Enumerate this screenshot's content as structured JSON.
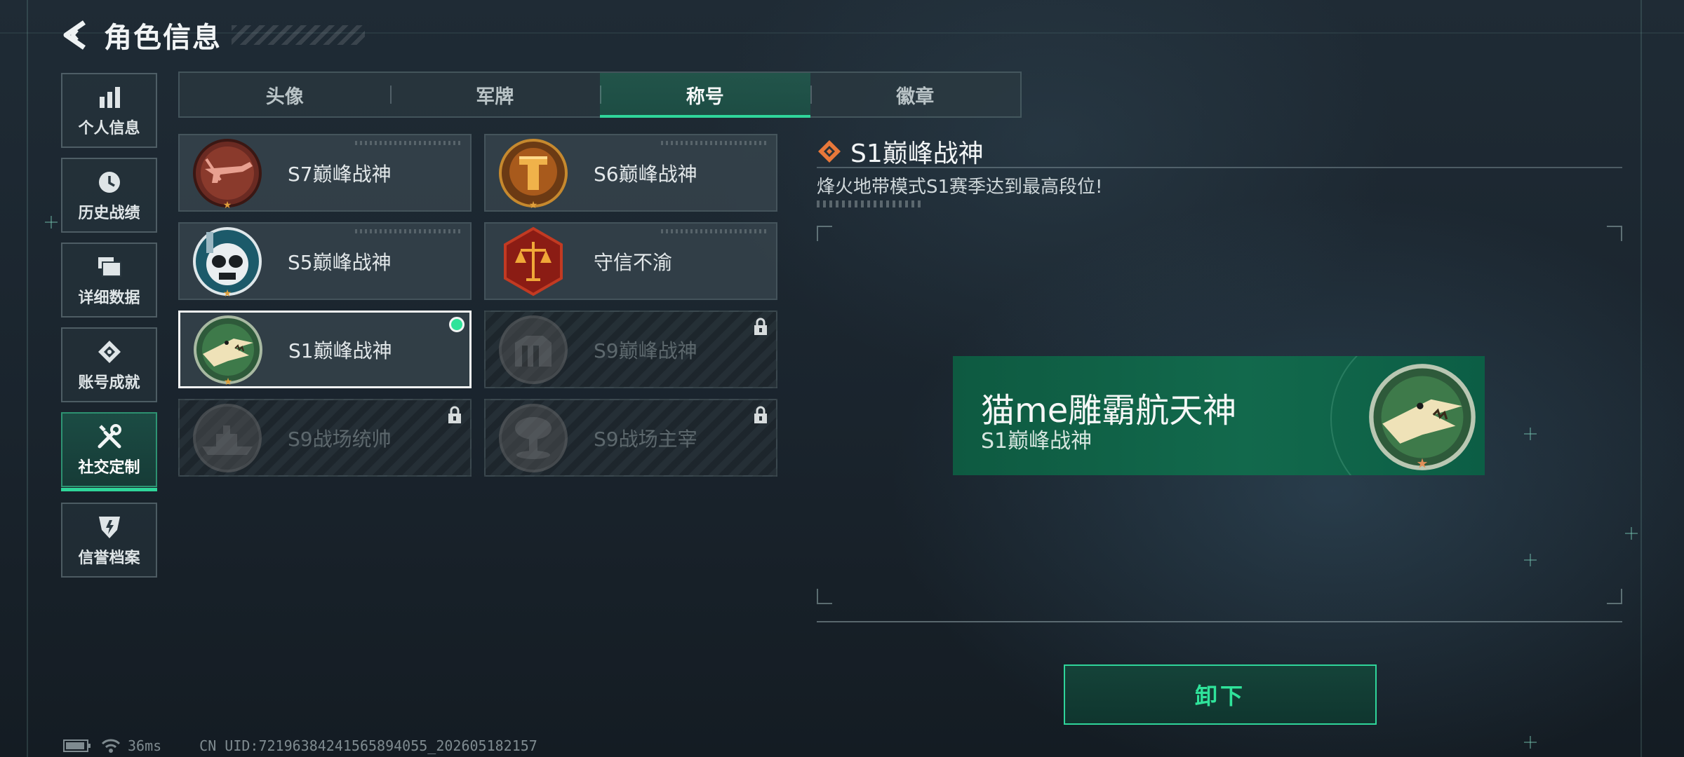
{
  "header": {
    "title": "角色信息"
  },
  "sidebar": {
    "items": [
      {
        "label": "个人信息",
        "icon": "bar-chart-icon"
      },
      {
        "label": "历史战绩",
        "icon": "clock-icon"
      },
      {
        "label": "详细数据",
        "icon": "folder-icon"
      },
      {
        "label": "账号成就",
        "icon": "achievement-icon"
      },
      {
        "label": "社交定制",
        "icon": "tools-icon",
        "active": true
      },
      {
        "label": "信誉档案",
        "icon": "shield-icon"
      }
    ]
  },
  "tabs": [
    {
      "label": "头像"
    },
    {
      "label": "军牌"
    },
    {
      "label": "称号",
      "active": true
    },
    {
      "label": "徽章"
    }
  ],
  "titles": [
    {
      "name": "S7巅峰战神",
      "locked": false
    },
    {
      "name": "S6巅峰战神",
      "locked": false
    },
    {
      "name": "S5巅峰战神",
      "locked": false
    },
    {
      "name": "守信不渝",
      "locked": false
    },
    {
      "name": "S1巅峰战神",
      "locked": false,
      "selected": true,
      "equipped": true
    },
    {
      "name": "S9巅峰战神",
      "locked": true
    },
    {
      "name": "S9战场统帅",
      "locked": true
    },
    {
      "name": "S9战场主宰",
      "locked": true
    }
  ],
  "detail": {
    "title": "S1巅峰战神",
    "description": "烽火地带模式S1赛季达到最高段位!"
  },
  "nameplate": {
    "player_name": "猫me雕霸航天神",
    "title": "S1巅峰战神"
  },
  "actions": {
    "unequip_label": "卸下"
  },
  "status": {
    "ping": "36ms",
    "uid": "CN UID:7219638424156589405​5_202605182157"
  },
  "colors": {
    "accent": "#2fd59a",
    "plate": "#12694c"
  }
}
